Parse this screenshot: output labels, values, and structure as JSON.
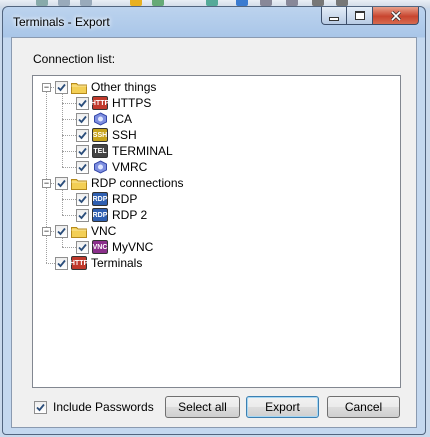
{
  "window": {
    "title": "Terminals - Export"
  },
  "dialog": {
    "connection_list_label": "Connection list:"
  },
  "tree": {
    "groups": [
      {
        "label": "Other things",
        "checked": true,
        "expanded": true,
        "items": [
          {
            "label": "HTTPS",
            "icon": "https-icon",
            "icon_text": "HTTP",
            "checked": true
          },
          {
            "label": "ICA",
            "icon": "ica-icon",
            "checked": true
          },
          {
            "label": "SSH",
            "icon": "ssh-icon",
            "icon_text": "SSH",
            "checked": true
          },
          {
            "label": "TERMINAL",
            "icon": "telnet-icon",
            "icon_text": "TEL",
            "checked": true
          },
          {
            "label": "VMRC",
            "icon": "vmrc-icon",
            "checked": true
          }
        ]
      },
      {
        "label": "RDP connections",
        "checked": true,
        "expanded": true,
        "items": [
          {
            "label": "RDP",
            "icon": "rdp-icon",
            "icon_text": "RDP",
            "checked": true
          },
          {
            "label": "RDP 2",
            "icon": "rdp-icon",
            "icon_text": "RDP",
            "checked": true
          }
        ]
      },
      {
        "label": "VNC",
        "checked": true,
        "expanded": true,
        "items": [
          {
            "label": "MyVNC",
            "icon": "vnc-icon",
            "icon_text": "VNC",
            "checked": true
          }
        ]
      }
    ],
    "root_items": [
      {
        "label": "Terminals",
        "icon": "http-icon",
        "icon_text": "HTTP",
        "checked": true
      }
    ]
  },
  "footer": {
    "include_passwords_label": "Include Passwords",
    "include_passwords_checked": true,
    "select_all_label": "Select all",
    "export_label": "Export",
    "cancel_label": "Cancel"
  },
  "colors": {
    "http": "#c0392b",
    "ssh": "#c8a51c",
    "telnet": "#444444",
    "rdp": "#2f5fb0",
    "vnc": "#8b2f8b",
    "folder": "#f3cf55"
  }
}
